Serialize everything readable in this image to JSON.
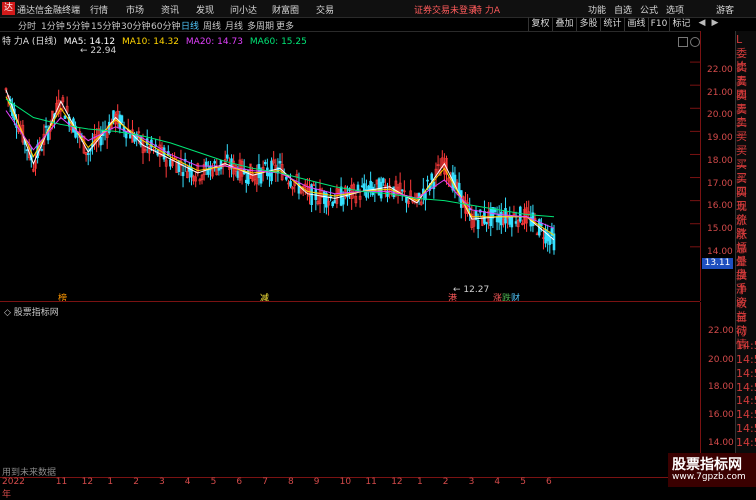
{
  "app": {
    "title": "通达信金融终端",
    "logo": "达"
  },
  "menu": [
    "行情",
    "市场",
    "资讯",
    "发现",
    "问小达",
    "财富圈",
    "交易"
  ],
  "login_link": "证券交易未登录",
  "stock_name": "特 力A",
  "right_menu": [
    "功能",
    "自选",
    "公式",
    "选项",
    "游客"
  ],
  "periods": [
    "分时",
    "1分钟",
    "5分钟",
    "15分钟",
    "30分钟",
    "60分钟",
    "日线",
    "周线",
    "月线",
    "多周期",
    "更多"
  ],
  "active_period": "日线",
  "toolbar_buttons": [
    "复权",
    "叠加",
    "多股",
    "统计",
    "画线",
    "F10",
    "标记"
  ],
  "chart_title": "特 力A (日线)",
  "ma": [
    {
      "label": "MA5: 14.12",
      "color": "#ffffff"
    },
    {
      "label": "MA10: 14.32",
      "color": "#ffd400"
    },
    {
      "label": "MA20: 14.73",
      "color": "#e040fb"
    },
    {
      "label": "MA60: 15.25",
      "color": "#00e676"
    }
  ],
  "annotations": {
    "high": "22.94",
    "low": "12.27"
  },
  "event_markers": [
    {
      "text": "榜",
      "color": "#ff9800"
    },
    {
      "text": "减",
      "color": "#ffeb3b"
    },
    {
      "text": "港",
      "color": "#ff5b5b"
    },
    {
      "text": "涨",
      "color": "#ff5b5b"
    },
    {
      "text": "跌",
      "color": "#4caf50"
    },
    {
      "text": "财",
      "color": "#4fc3f7"
    }
  ],
  "price_ticks": [
    "22.00",
    "21.00",
    "20.00",
    "19.00",
    "18.00",
    "17.00",
    "16.00",
    "15.00",
    "14.00"
  ],
  "current_price": "13.11",
  "right_panel": [
    "L",
    "委比",
    "卖五",
    "卖四",
    "卖三",
    "卖二",
    "卖一",
    "买一",
    "买二",
    "买三",
    "买四",
    "买五",
    "现价",
    "涨跌",
    "涨幅",
    "总量",
    "外盘",
    "换手",
    "净资",
    "收益",
    "自动",
    "行情",
    "14:5",
    "14:5",
    "14:5",
    "14:5",
    "14:5",
    "14:5",
    "14:5",
    "14:5"
  ],
  "indicator_title": "股票指标网",
  "indicator_ticks": [
    "22.00",
    "20.00",
    "18.00",
    "16.00",
    "14.00"
  ],
  "no_data": "用到未来数据",
  "date_ticks": [
    "2022年",
    "11",
    "12",
    "1",
    "2",
    "3",
    "4",
    "5",
    "6",
    "7",
    "8",
    "9",
    "10",
    "11",
    "12",
    "1",
    "2",
    "3",
    "4",
    "5",
    "6"
  ],
  "watermark": {
    "line1": "股票指标网",
    "line2": "www.7gpzb.com"
  },
  "chart_data": {
    "type": "line",
    "title": "特 力A (日线)",
    "ylim": [
      12.0,
      23.0
    ],
    "x": [
      "2022-10",
      "2022-11",
      "2022-12",
      "2023-01",
      "2023-02",
      "2023-03",
      "2023-04",
      "2023-05",
      "2023-06",
      "2023-07",
      "2023-08",
      "2023-09",
      "2023-10",
      "2023-11",
      "2023-12",
      "2024-01",
      "2024-02",
      "2024-03",
      "2024-04",
      "2024-05",
      "2024-06"
    ],
    "series": [
      {
        "name": "MA5",
        "values": [
          20.8,
          17.6,
          20.3,
          18.1,
          19.6,
          18.4,
          17.8,
          17.2,
          17.6,
          17.1,
          17.4,
          16.3,
          16.1,
          16.4,
          16.6,
          15.9,
          17.6,
          15.2,
          15.3,
          15.3,
          14.3
        ]
      },
      {
        "name": "MA10",
        "values": [
          20.5,
          17.9,
          20.0,
          18.3,
          19.5,
          18.6,
          17.9,
          17.3,
          17.5,
          17.2,
          17.3,
          16.4,
          16.2,
          16.4,
          16.5,
          16.0,
          17.4,
          15.3,
          15.3,
          15.3,
          14.5
        ]
      },
      {
        "name": "MA20",
        "values": [
          19.9,
          18.2,
          19.6,
          18.6,
          19.2,
          18.7,
          18.0,
          17.5,
          17.5,
          17.3,
          17.2,
          16.6,
          16.3,
          16.4,
          16.4,
          16.1,
          16.9,
          15.6,
          15.4,
          15.3,
          14.8
        ]
      },
      {
        "name": "MA60",
        "values": [
          20.4,
          19.6,
          19.3,
          19.1,
          19.0,
          18.8,
          18.5,
          18.1,
          17.7,
          17.4,
          17.2,
          16.9,
          16.6,
          16.4,
          16.3,
          16.1,
          16.0,
          15.8,
          15.6,
          15.4,
          15.3
        ]
      }
    ]
  }
}
